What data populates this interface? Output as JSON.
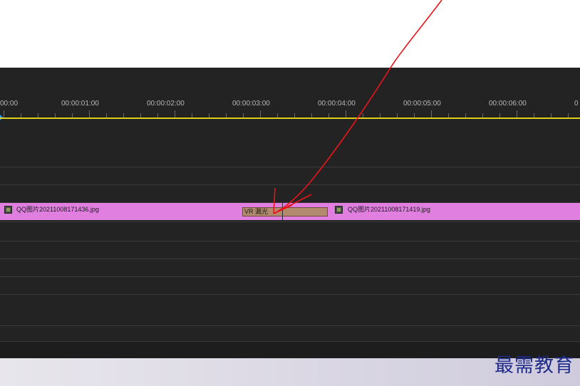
{
  "timeline": {
    "timecodes": [
      "00:00",
      "00:00:01:00",
      "00:00:02:00",
      "00:00:03:00",
      "00:00:04:00",
      "00:00:05:00",
      "00:00:06:00",
      "0"
    ],
    "clips": [
      {
        "label": "QQ图片20211008171436.jpg"
      },
      {
        "label": "QQ图片20211008171419.jpg"
      }
    ],
    "transition": {
      "label": "VR 漏光"
    }
  },
  "watermark": "最需教育",
  "colors": {
    "panel_bg": "#232323",
    "clip_pink": "#e17fe1",
    "transition_brown": "#b48a6e",
    "ruler_line": "#e0cf1a",
    "annotation_red": "#e8141a",
    "watermark_blue": "#1e2b8a"
  }
}
